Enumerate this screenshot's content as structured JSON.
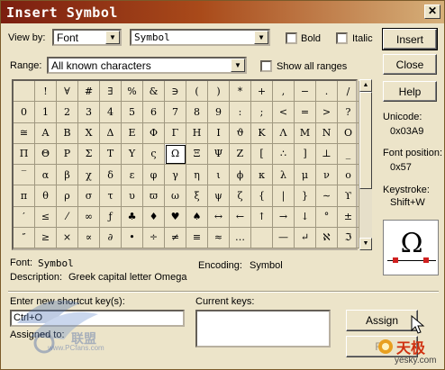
{
  "window": {
    "title": "Insert Symbol",
    "close_glyph": "✕"
  },
  "view_by": {
    "label": "View by:",
    "value": "Font",
    "font_value": "Symbol"
  },
  "options": {
    "bold": "Bold",
    "italic": "Italic",
    "show_all_ranges": "Show all ranges"
  },
  "range": {
    "label": "Range:",
    "value": "All known characters"
  },
  "buttons": {
    "insert": "Insert",
    "close": "Close",
    "help": "Help",
    "assign": "Assign",
    "remove": "Re"
  },
  "info": {
    "unicode_label": "Unicode:",
    "unicode_value": "0x03A9",
    "font_position_label": "Font position:",
    "font_position_value": "0x57",
    "keystroke_label": "Keystroke:",
    "keystroke_value": "Shift+W",
    "preview_glyph": "Ω"
  },
  "details": {
    "font_label": "Font:",
    "font_value": "Symbol",
    "encoding_label": "Encoding:",
    "encoding_value": "Symbol",
    "description_label": "Description:",
    "description_value": "Greek capital letter Omega"
  },
  "shortcut": {
    "new_label": "Enter new shortcut key(s):",
    "new_value": "Ctrl+O",
    "current_label": "Current keys:",
    "assigned_label": "Assigned to:"
  },
  "grid": {
    "selected_index": 55,
    "rows": [
      [
        "",
        "!",
        "∀",
        "#",
        "∃",
        "%",
        "&",
        "∋",
        "(",
        ")",
        "*",
        "+",
        ",",
        "−",
        ".",
        "/"
      ],
      [
        "0",
        "1",
        "2",
        "3",
        "4",
        "5",
        "6",
        "7",
        "8",
        "9",
        ":",
        ";",
        "<",
        "=",
        ">",
        "?"
      ],
      [
        "≅",
        "Α",
        "Β",
        "Χ",
        "Δ",
        "Ε",
        "Φ",
        "Γ",
        "Η",
        "Ι",
        "ϑ",
        "Κ",
        "Λ",
        "Μ",
        "Ν",
        "Ο"
      ],
      [
        "Π",
        "Θ",
        "Ρ",
        "Σ",
        "Τ",
        "Υ",
        "ς",
        "Ω",
        "Ξ",
        "Ψ",
        "Ζ",
        "[",
        "∴",
        "]",
        "⊥",
        "_"
      ],
      [
        "‾",
        "α",
        "β",
        "χ",
        "δ",
        "ε",
        "φ",
        "γ",
        "η",
        "ι",
        "ϕ",
        "κ",
        "λ",
        "μ",
        "ν",
        "ο"
      ],
      [
        "π",
        "θ",
        "ρ",
        "σ",
        "τ",
        "υ",
        "ϖ",
        "ω",
        "ξ",
        "ψ",
        "ζ",
        "{",
        "|",
        "}",
        "∼",
        "ϒ"
      ],
      [
        "′",
        "≤",
        "⁄",
        "∞",
        "ƒ",
        "♣",
        "♦",
        "♥",
        "♠",
        "↔",
        "←",
        "↑",
        "→",
        "↓",
        "°",
        "±"
      ],
      [
        "″",
        "≥",
        "×",
        "∝",
        "∂",
        "•",
        "÷",
        "≠",
        "≡",
        "≈",
        "…",
        "",
        "—",
        "↵",
        "ℵ",
        "ℑ"
      ]
    ]
  },
  "watermark": {
    "site": "www.PCfans.com",
    "brand": "天极",
    "domain": "yesky.com"
  }
}
